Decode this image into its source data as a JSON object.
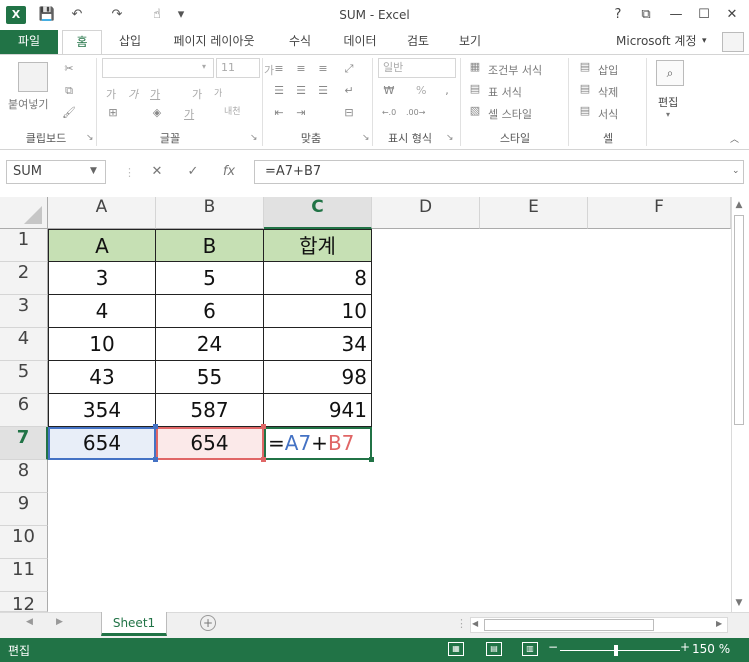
{
  "window": {
    "title": "SUM - Excel",
    "logo": "X",
    "controls": {
      "help": "?",
      "restore_ribbon": "⧉",
      "minimize": "—",
      "maximize": "☐",
      "close": "✕"
    }
  },
  "qat": {
    "save": "💾",
    "undo": "↶",
    "redo": "↷",
    "touch": "☝",
    "customize": "▾"
  },
  "tabs": [
    "파일",
    "홈",
    "삽입",
    "페이지 레이아웃",
    "수식",
    "데이터",
    "검토",
    "보기"
  ],
  "active_tab": "홈",
  "account": "Microsoft 계정",
  "ribbon": {
    "clipboard": {
      "paste": "붙여넣기",
      "label": "클립보드"
    },
    "font": {
      "font_name": "",
      "font_size": "11",
      "bold": "가",
      "italic": "가",
      "underline": "가",
      "grow": "가",
      "shrink": "가",
      "phonetic": "내천",
      "color": "가",
      "label": "글꼴"
    },
    "alignment": {
      "label": "맞춤"
    },
    "number": {
      "format": "일반",
      "percent": "%",
      "label": "표시 형식"
    },
    "styles": {
      "conditional": "조건부 서식",
      "table": "표 서식",
      "cell": "셀 스타일",
      "label": "스타일"
    },
    "cells": {
      "insert": "삽입",
      "delete": "삭제",
      "format": "서식",
      "label": "셀"
    },
    "editing": {
      "label": "편집"
    }
  },
  "formula_bar": {
    "name_box": "SUM",
    "formula": "=A7+B7",
    "cancel": "✕",
    "enter": "✓",
    "fx": "fx"
  },
  "columns": [
    "A",
    "B",
    "C",
    "D",
    "E",
    "F"
  ],
  "rows": [
    "1",
    "2",
    "3",
    "4",
    "5",
    "6",
    "7",
    "8",
    "9",
    "10",
    "11",
    "12"
  ],
  "table": {
    "header": [
      "A",
      "B",
      "합계"
    ],
    "data": [
      [
        "3",
        "5",
        "8"
      ],
      [
        "4",
        "6",
        "10"
      ],
      [
        "10",
        "24",
        "34"
      ],
      [
        "43",
        "55",
        "98"
      ],
      [
        "354",
        "587",
        "941"
      ]
    ],
    "row7": {
      "a": "654",
      "b": "654",
      "c_prefix": "=",
      "c_ref_a": "A7",
      "c_op": "+",
      "c_ref_b": "B7"
    }
  },
  "selection": {
    "column": "C",
    "row": "7"
  },
  "sheet": {
    "tab": "Sheet1",
    "add": "+"
  },
  "status": {
    "mode": "편집",
    "zoom": "150 %"
  },
  "colors": {
    "accent": "#217346",
    "header_fill": "#c6e0b4",
    "ref_a": "#4472c4",
    "ref_b": "#e06666"
  }
}
